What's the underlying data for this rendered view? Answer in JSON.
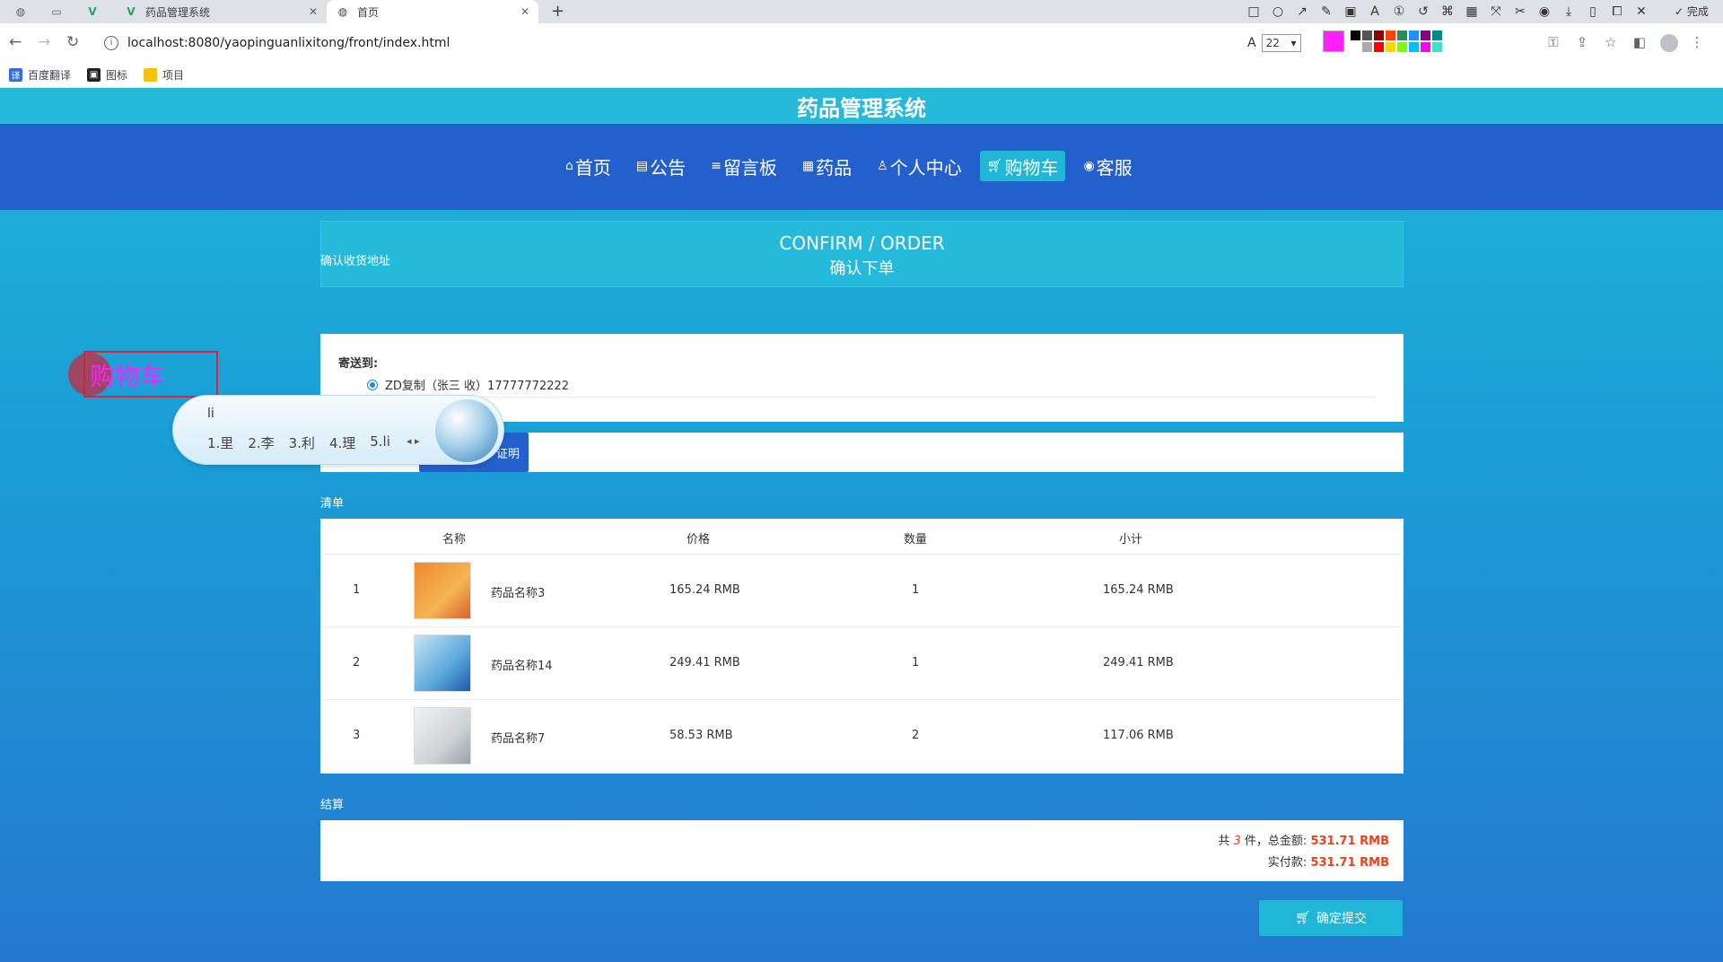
{
  "browser": {
    "tabs": [
      {
        "title": "药品管理系统",
        "active": false
      },
      {
        "title": "首页",
        "active": true
      }
    ],
    "url": "localhost:8080/yaopinguanlixitong/front/index.html",
    "font_size": "22",
    "snip_done_label": "完成",
    "bookmarks": [
      "百度翻译",
      "图标",
      "项目"
    ],
    "palette": [
      "#000000",
      "#555555",
      "#8b0000",
      "#ff4500",
      "#2e8b57",
      "#1e90ff",
      "#8b008b",
      "#008b8b",
      "#ffffff",
      "#aaaaaa",
      "#ff0000",
      "#ffd700",
      "#7cfc00",
      "#00bfff",
      "#ff00ff",
      "#40e0d0"
    ],
    "current_color": "#ff1fff"
  },
  "site": {
    "title": "药品管理系统",
    "nav": [
      {
        "label": "首页",
        "icon": "home-icon",
        "active": false
      },
      {
        "label": "公告",
        "icon": "notice-icon",
        "active": false
      },
      {
        "label": "留言板",
        "icon": "message-icon",
        "active": false
      },
      {
        "label": "药品",
        "icon": "medicine-icon",
        "active": false
      },
      {
        "label": "个人中心",
        "icon": "user-icon",
        "active": false
      },
      {
        "label": "购物车",
        "icon": "cart-icon",
        "active": true
      },
      {
        "label": "客服",
        "icon": "service-icon",
        "active": false
      }
    ]
  },
  "order": {
    "banner_en": "CONFIRM / ORDER",
    "banner_zh": "确认下单",
    "address_section": "确认收货地址",
    "ship_to_label": "寄送到:",
    "address": "ZD复制（张三 收）17777772222",
    "proof_button": "证明",
    "list_section": "清单",
    "columns": [
      "名称",
      "价格",
      "数量",
      "小计"
    ],
    "items": [
      {
        "index": "1",
        "name": "药品名称3",
        "price": "165.24 RMB",
        "qty": "1",
        "subtotal": "165.24 RMB"
      },
      {
        "index": "2",
        "name": "药品名称14",
        "price": "249.41 RMB",
        "qty": "1",
        "subtotal": "249.41 RMB"
      },
      {
        "index": "3",
        "name": "药品名称7",
        "price": "58.53 RMB",
        "qty": "2",
        "subtotal": "117.06 RMB"
      }
    ],
    "settle_section": "结算",
    "total_prefix": "共",
    "total_count": "3",
    "total_mid": "件，总金额:",
    "total_amount": "531.71 RMB",
    "paid_label": "实付款:",
    "paid_amount": "531.71 RMB",
    "submit_label": "确定提交"
  },
  "overlays": {
    "annotation_text": "购物车",
    "ime_composition": "li",
    "ime_candidates": [
      "1.里",
      "2.李",
      "3.利",
      "4.理",
      "5.li"
    ]
  }
}
